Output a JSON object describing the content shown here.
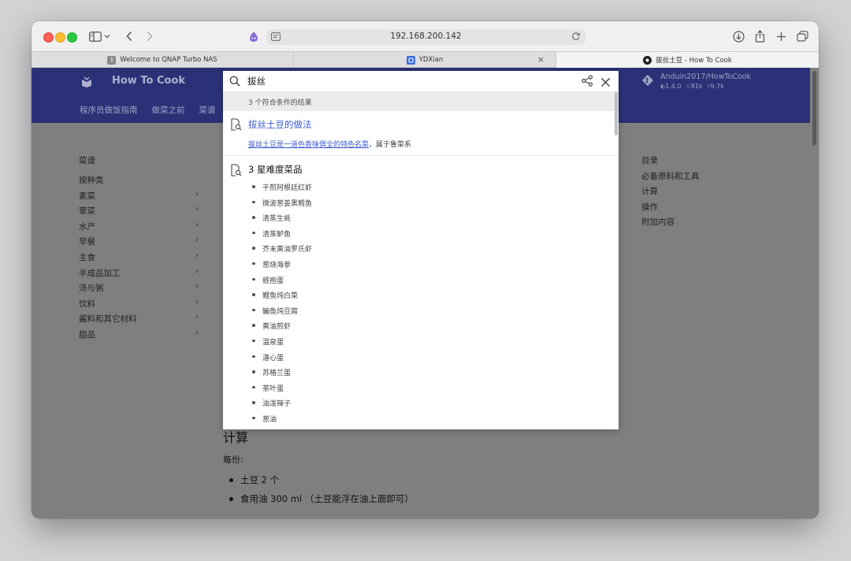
{
  "browser": {
    "address": "192.168.200.142",
    "tabs": [
      {
        "title": "Welcome to QNAP Turbo NAS",
        "favicon": "1"
      },
      {
        "title": "YDXian",
        "favicon": ""
      },
      {
        "title": "拔丝土豆 - How To Cook",
        "favicon": ""
      }
    ]
  },
  "site": {
    "brand": "How To Cook",
    "nav": [
      "程序员做饭指南",
      "做菜之前",
      "菜谱"
    ],
    "repo": {
      "name": "Anduin2017/HowToCook",
      "version": "1.4.0",
      "stars": "81k",
      "forks": "9.7k"
    }
  },
  "sidebar": {
    "title": "菜谱",
    "items": [
      {
        "label": "按种类"
      },
      {
        "label": "素菜"
      },
      {
        "label": "荤菜"
      },
      {
        "label": "水产"
      },
      {
        "label": "早餐"
      },
      {
        "label": "主食"
      },
      {
        "label": "半成品加工"
      },
      {
        "label": "汤与粥"
      },
      {
        "label": "饮料"
      },
      {
        "label": "酱料和其它材料"
      },
      {
        "label": "甜品"
      }
    ]
  },
  "toc": {
    "title": "目录",
    "items": [
      "必备原料和工具",
      "计算",
      "操作",
      "附加内容"
    ]
  },
  "main": {
    "heading": "计算",
    "serving": "每份:",
    "ingredients": [
      "土豆 2 个",
      "食用油 300 ml （土豆能浮在油上面即可）"
    ]
  },
  "search": {
    "query": "拔丝",
    "placeholder": "拔丝土豆的做法",
    "result_count": "3 个符合条件的结果",
    "results": [
      {
        "title": "拔丝土豆的做法",
        "snippet_link": "拔丝土豆是一道色香味俱全的特色名菜",
        "snippet_rest": "，属于鲁菜系"
      },
      {
        "title": "3 星难度菜品",
        "items": [
          "干煎阿根廷红虾",
          "微波葱姜黑鳕鱼",
          "清蒸生蚝",
          "清蒸鲈鱼",
          "芥末黄油罗氏虾",
          "葱烧海参",
          "蛏抱蛋",
          "鲤鱼炖白菜",
          "鳊鱼炖豆腐",
          "黄油煎虾",
          "温泉蛋",
          "溏心蛋",
          "苏格兰蛋",
          "茶叶蛋",
          "油泼辣子",
          "葱油"
        ]
      }
    ]
  }
}
